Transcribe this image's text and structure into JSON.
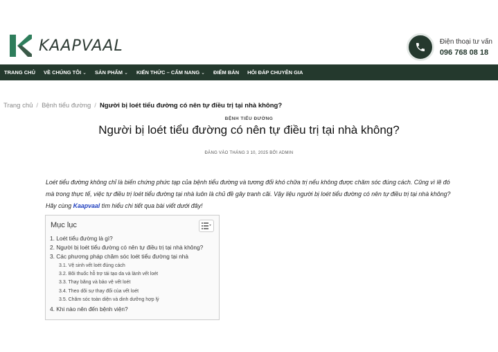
{
  "brand": {
    "logo_text": "KAAPVAAL",
    "colors": {
      "primary": "#24392d",
      "logo_green": "#2e7d5b",
      "link": "#1f3fbf"
    }
  },
  "contact": {
    "label": "Điện thoại tư vấn",
    "phone": "096 768 08 18",
    "icon": "phone-icon"
  },
  "nav": [
    {
      "label": "TRANG CHỦ",
      "dropdown": false
    },
    {
      "label": "VỀ CHÚNG TÔI",
      "dropdown": true
    },
    {
      "label": "SẢN PHẨM",
      "dropdown": true
    },
    {
      "label": "KIẾN THỨC – CẨM NANG",
      "dropdown": true
    },
    {
      "label": "ĐIỂM BÁN",
      "dropdown": false
    },
    {
      "label": "HỎI ĐÁP CHUYÊN GIA",
      "dropdown": false
    }
  ],
  "breadcrumb": {
    "home": "Trang chủ",
    "sep": "/",
    "category": "Bệnh tiểu đường",
    "current": "Người bị loét tiểu đường có nên tự điều trị tại nhà không?"
  },
  "article": {
    "category": "BỆNH TIỂU ĐƯỜNG",
    "title": "Người bị loét tiểu đường có nên tự điều trị tại nhà không?",
    "meta": "ĐĂNG VÀO THÁNG 3 10, 2025 BỞI ADMIN",
    "intro_before": "Loét tiểu đường không chỉ là biến chứng phức tạp của bệnh tiểu đường và tương đối khó chữa trị nếu không được chăm sóc đúng cách. Cũng vì lẽ đó mà trong thực tế, việc tự điều trị loét tiểu đường tại nhà luôn là chủ đề gây tranh cãi. Vậy liệu người bị loét tiểu đường có nên tự điều trị tại nhà không? Hãy cùng ",
    "intro_link": "Kaapvaal",
    "intro_after": " tìm hiểu chi tiết qua bài viết dưới đây!"
  },
  "toc": {
    "title": "Mục lục",
    "items": [
      {
        "label": "1. Loét tiểu đường là gì?",
        "level": 1
      },
      {
        "label": "2. Người bị loét tiểu đường có nên tự điều trị tại nhà không?",
        "level": 1
      },
      {
        "label": "3. Các phương pháp chăm sóc loét tiểu đường tại nhà",
        "level": 1
      },
      {
        "label": "3.1. Vệ sinh vết loét đúng cách",
        "level": 2
      },
      {
        "label": "3.2. Bôi thuốc hỗ trợ tái tạo da và lành vết loét",
        "level": 2
      },
      {
        "label": "3.3. Thay băng và bảo vệ vết loét",
        "level": 2
      },
      {
        "label": "3.4. Theo dõi sự thay đổi của vết loét",
        "level": 2
      },
      {
        "label": "3.5. Chăm sóc toàn diện và dinh dưỡng hợp lý",
        "level": 2
      },
      {
        "label": "4. Khi nào nên đến bệnh viện?",
        "level": 1
      }
    ]
  }
}
